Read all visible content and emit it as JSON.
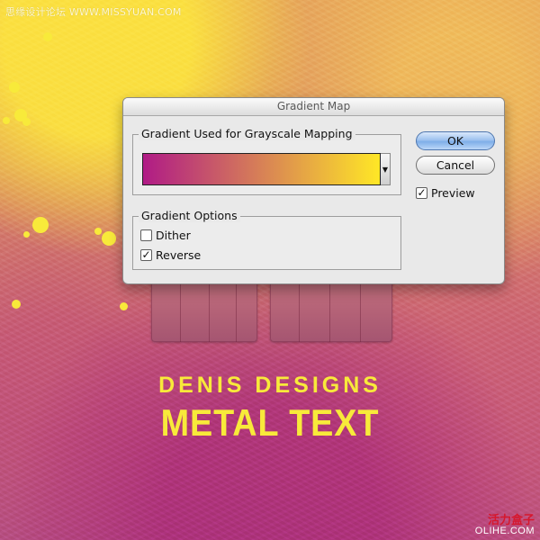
{
  "watermark": {
    "top_text": "思缘设计论坛 WWW.MISSYUAN.COM",
    "bottom_cn": "活力盒子",
    "bottom_en": "OLIHE.COM"
  },
  "artwork": {
    "line1": "DENIS DESIGNS",
    "line2": "METAL TEXT"
  },
  "dialog": {
    "title": "Gradient Map",
    "gradient_group_title": "Gradient Used for Grayscale Mapping",
    "gradient": {
      "start_color": "#b01b86",
      "end_color": "#ffe726"
    },
    "options_group_title": "Gradient Options",
    "dither": {
      "label": "Dither",
      "checked": false
    },
    "reverse": {
      "label": "Reverse",
      "checked": true
    },
    "ok_label": "OK",
    "cancel_label": "Cancel",
    "preview": {
      "label": "Preview",
      "checked": true
    }
  },
  "colors": {
    "accent_yellow": "#f8ea3a",
    "background_pink": "#c86c78"
  }
}
